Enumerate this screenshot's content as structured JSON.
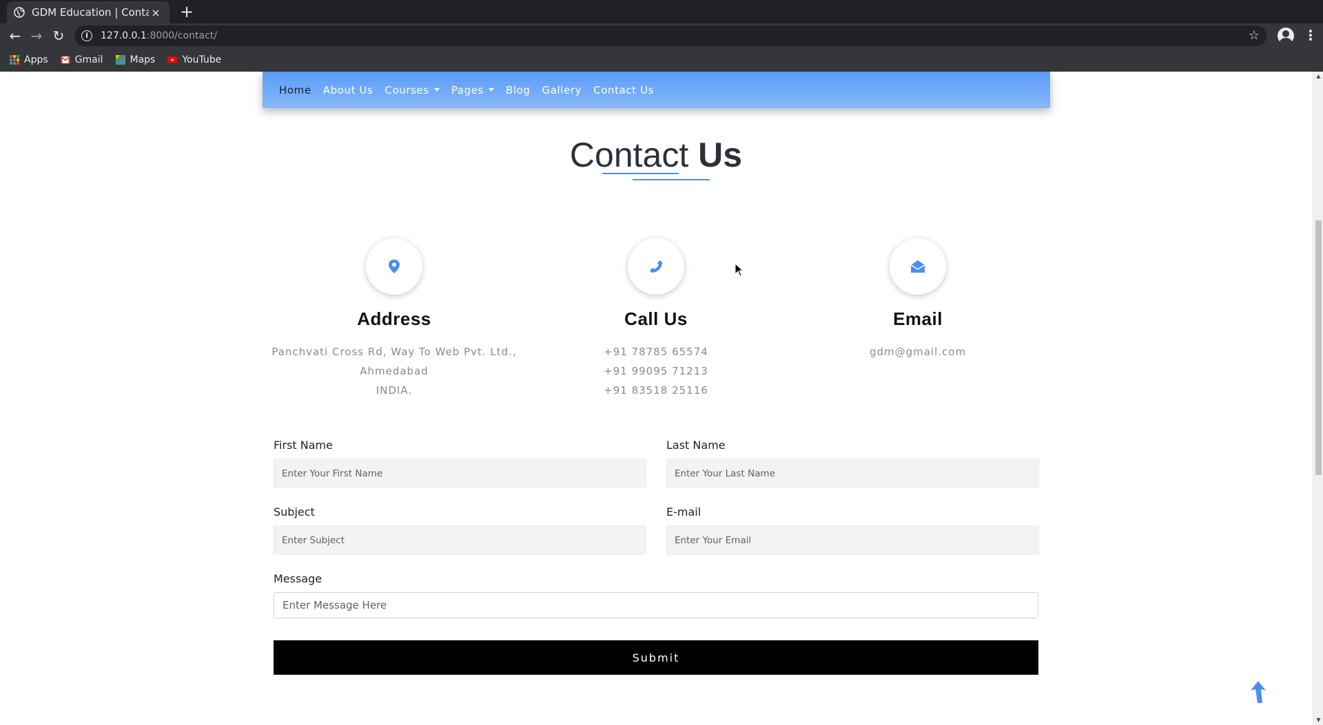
{
  "browser": {
    "tab_title": "GDM Education | Contact",
    "tab_close": "×",
    "new_tab": "+",
    "url_host": "127.0.0.1",
    "url_rest": ":8000/contact/",
    "bookmarks": [
      "Apps",
      "Gmail",
      "Maps",
      "YouTube"
    ]
  },
  "nav": {
    "items": [
      {
        "label": "Home",
        "active": true
      },
      {
        "label": "About Us"
      },
      {
        "label": "Courses",
        "dropdown": true
      },
      {
        "label": "Pages",
        "dropdown": true
      },
      {
        "label": "Blog"
      },
      {
        "label": "Gallery"
      },
      {
        "label": "Contact Us"
      }
    ]
  },
  "section": {
    "title_light": "Contact",
    "title_bold": "Us"
  },
  "cards": {
    "address": {
      "title": "Address",
      "lines": [
        "Panchvati Cross Rd, Way To Web Pvt. Ltd.,",
        "Ahmedabad",
        "INDIA."
      ]
    },
    "call": {
      "title": "Call Us",
      "lines": [
        "+91 78785 65574",
        "+91 99095 71213",
        "+91 83518 25116"
      ]
    },
    "email": {
      "title": "Email",
      "lines": [
        "gdm@gmail.com"
      ]
    }
  },
  "form": {
    "first_name": {
      "label": "First Name",
      "placeholder": "Enter Your First Name"
    },
    "last_name": {
      "label": "Last Name",
      "placeholder": "Enter Your Last Name"
    },
    "subject": {
      "label": "Subject",
      "placeholder": "Enter Subject"
    },
    "email": {
      "label": "E-mail",
      "placeholder": "Enter Your Email"
    },
    "message": {
      "label": "Message",
      "placeholder": "Enter Message Here"
    },
    "submit": "Submit"
  },
  "colors": {
    "accent": "#4a8ef5",
    "navbar_top": "#5b9bf6",
    "navbar_bottom": "#86b8fb",
    "submit_bg": "#000000"
  }
}
